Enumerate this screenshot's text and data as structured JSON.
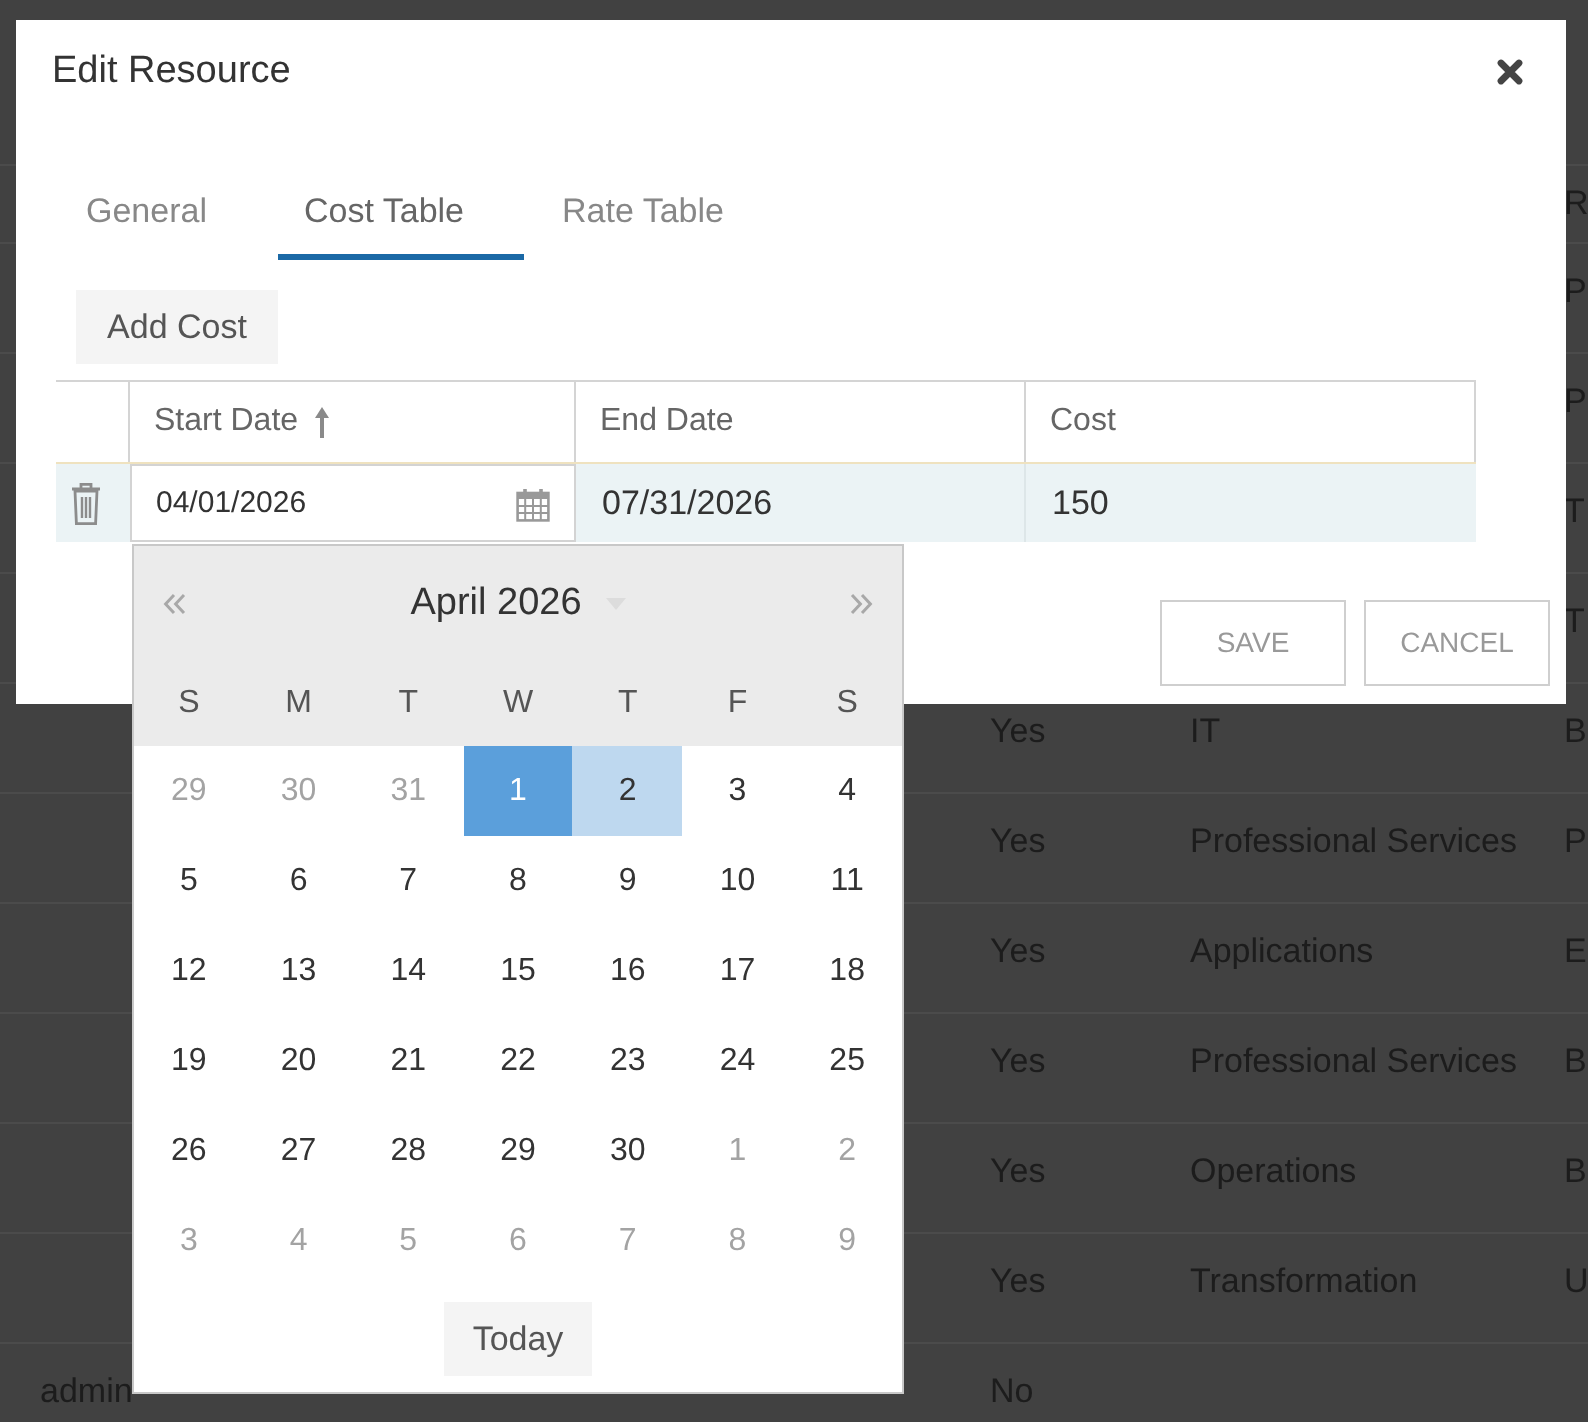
{
  "background_table": {
    "header": {
      "column_4": "R"
    },
    "rows": [
      {
        "column_4": "P"
      },
      {
        "column_4": "P"
      },
      {
        "column_4": "T"
      },
      {
        "column_4": "T"
      },
      {
        "column_2": "Yes",
        "column_3": "IT",
        "column_4": "B"
      },
      {
        "column_2": "Yes",
        "column_3": "Professional Services",
        "column_4": "P"
      },
      {
        "column_2": "Yes",
        "column_3": "Applications",
        "column_4": "E"
      },
      {
        "column_2": "Yes",
        "column_3": "Professional Services",
        "column_4": "B"
      },
      {
        "column_2": "Yes",
        "column_3": "Operations",
        "column_4": "B"
      },
      {
        "column_2": "Yes",
        "column_3": "Transformation",
        "column_4": "U"
      },
      {
        "column_1": "admin",
        "column_2": "No"
      }
    ]
  },
  "dialog": {
    "title": "Edit Resource",
    "tabs": [
      {
        "label": "General",
        "selected": false
      },
      {
        "label": "Cost Table",
        "selected": true
      },
      {
        "label": "Rate Table",
        "selected": false
      }
    ],
    "add_button": "Add Cost",
    "cost_table": {
      "columns": [
        {
          "label": "Start Date",
          "sorted": true
        },
        {
          "label": "End Date",
          "sorted": false
        },
        {
          "label": "Cost",
          "sorted": false
        }
      ],
      "rows": [
        {
          "start_date": "04/01/2026",
          "end_date": "07/31/2026",
          "cost": "150",
          "editing": true
        }
      ]
    },
    "buttons": [
      {
        "label": "SAVE"
      },
      {
        "label": "CANCEL"
      }
    ]
  },
  "date_picker": {
    "month": "April 2026",
    "weekdays": [
      "S",
      "M",
      "T",
      "W",
      "T",
      "F",
      "S"
    ],
    "days": [
      {
        "label": "29",
        "muted": true,
        "selected": false,
        "highlighted": false
      },
      {
        "label": "30",
        "muted": true,
        "selected": false,
        "highlighted": false
      },
      {
        "label": "31",
        "muted": true,
        "selected": false,
        "highlighted": false
      },
      {
        "label": "1",
        "muted": false,
        "selected": true,
        "highlighted": false
      },
      {
        "label": "2",
        "muted": false,
        "selected": false,
        "highlighted": true
      },
      {
        "label": "3",
        "muted": false,
        "selected": false,
        "highlighted": false
      },
      {
        "label": "4",
        "muted": false,
        "selected": false,
        "highlighted": false
      },
      {
        "label": "5",
        "muted": false,
        "selected": false,
        "highlighted": false
      },
      {
        "label": "6",
        "muted": false,
        "selected": false,
        "highlighted": false
      },
      {
        "label": "7",
        "muted": false,
        "selected": false,
        "highlighted": false
      },
      {
        "label": "8",
        "muted": false,
        "selected": false,
        "highlighted": false
      },
      {
        "label": "9",
        "muted": false,
        "selected": false,
        "highlighted": false
      },
      {
        "label": "10",
        "muted": false,
        "selected": false,
        "highlighted": false
      },
      {
        "label": "11",
        "muted": false,
        "selected": false,
        "highlighted": false
      },
      {
        "label": "12",
        "muted": false,
        "selected": false,
        "highlighted": false
      },
      {
        "label": "13",
        "muted": false,
        "selected": false,
        "highlighted": false
      },
      {
        "label": "14",
        "muted": false,
        "selected": false,
        "highlighted": false
      },
      {
        "label": "15",
        "muted": false,
        "selected": false,
        "highlighted": false
      },
      {
        "label": "16",
        "muted": false,
        "selected": false,
        "highlighted": false
      },
      {
        "label": "17",
        "muted": false,
        "selected": false,
        "highlighted": false
      },
      {
        "label": "18",
        "muted": false,
        "selected": false,
        "highlighted": false
      },
      {
        "label": "19",
        "muted": false,
        "selected": false,
        "highlighted": false
      },
      {
        "label": "20",
        "muted": false,
        "selected": false,
        "highlighted": false
      },
      {
        "label": "21",
        "muted": false,
        "selected": false,
        "highlighted": false
      },
      {
        "label": "22",
        "muted": false,
        "selected": false,
        "highlighted": false
      },
      {
        "label": "23",
        "muted": false,
        "selected": false,
        "highlighted": false
      },
      {
        "label": "24",
        "muted": false,
        "selected": false,
        "highlighted": false
      },
      {
        "label": "25",
        "muted": false,
        "selected": false,
        "highlighted": false
      },
      {
        "label": "26",
        "muted": false,
        "selected": false,
        "highlighted": false
      },
      {
        "label": "27",
        "muted": false,
        "selected": false,
        "highlighted": false
      },
      {
        "label": "28",
        "muted": false,
        "selected": false,
        "highlighted": false
      },
      {
        "label": "29",
        "muted": false,
        "selected": false,
        "highlighted": false
      },
      {
        "label": "30",
        "muted": false,
        "selected": false,
        "highlighted": false
      },
      {
        "label": "1",
        "muted": true,
        "selected": false,
        "highlighted": false
      },
      {
        "label": "2",
        "muted": true,
        "selected": false,
        "highlighted": false
      },
      {
        "label": "3",
        "muted": true,
        "selected": false,
        "highlighted": false
      },
      {
        "label": "4",
        "muted": true,
        "selected": false,
        "highlighted": false
      },
      {
        "label": "5",
        "muted": true,
        "selected": false,
        "highlighted": false
      },
      {
        "label": "6",
        "muted": true,
        "selected": false,
        "highlighted": false
      },
      {
        "label": "7",
        "muted": true,
        "selected": false,
        "highlighted": false
      },
      {
        "label": "8",
        "muted": true,
        "selected": false,
        "highlighted": false
      },
      {
        "label": "9",
        "muted": true,
        "selected": false,
        "highlighted": false
      }
    ],
    "today_button": "Today"
  }
}
